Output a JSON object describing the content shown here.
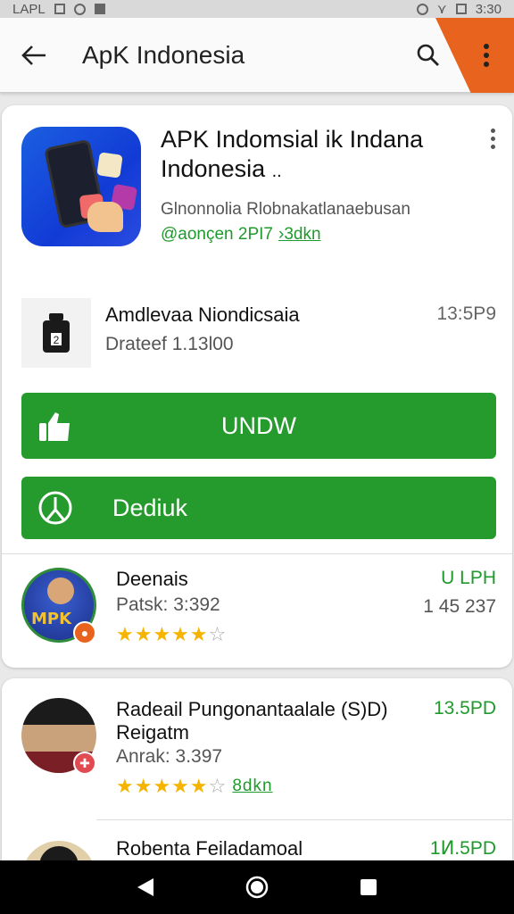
{
  "status_bar": {
    "left_text": "LAPL",
    "time": "3:30"
  },
  "app_bar": {
    "title": "ApK Indonesia"
  },
  "app": {
    "name": "APK Indomsial ik Indana Indonesia",
    "ellipsis": "..",
    "developer": "Glnonnolia Rlobnakatlanaebusan",
    "meta_prefix": "@aonçen 2PI7",
    "meta_link": "›3dkn"
  },
  "info": {
    "title": "Amdlevaa Niondicsaia",
    "subtitle": "Drateef 1.13l00",
    "time": "13:5P9"
  },
  "buttons": {
    "download": "UNDW",
    "detail": "Dediuk"
  },
  "reviews": [
    {
      "name": "Deenais",
      "sub": "Patsk: 3:392",
      "stars": 5,
      "right1": "U LPH",
      "right2": "1 45 237",
      "avatar_text": "MPK"
    },
    {
      "name": "Radeail Pungonantaalale (S)D) Reigatm",
      "sub": "Anrak: 3.397",
      "stars": 5,
      "link": "8dkn",
      "right1": "13.5PD"
    },
    {
      "name": "Robenta Feiladamoal",
      "right1": "1Ͷ.5PD"
    }
  ],
  "colors": {
    "accent_green": "#259b2e",
    "corner_orange": "#e8641e",
    "star": "#f4b400"
  }
}
